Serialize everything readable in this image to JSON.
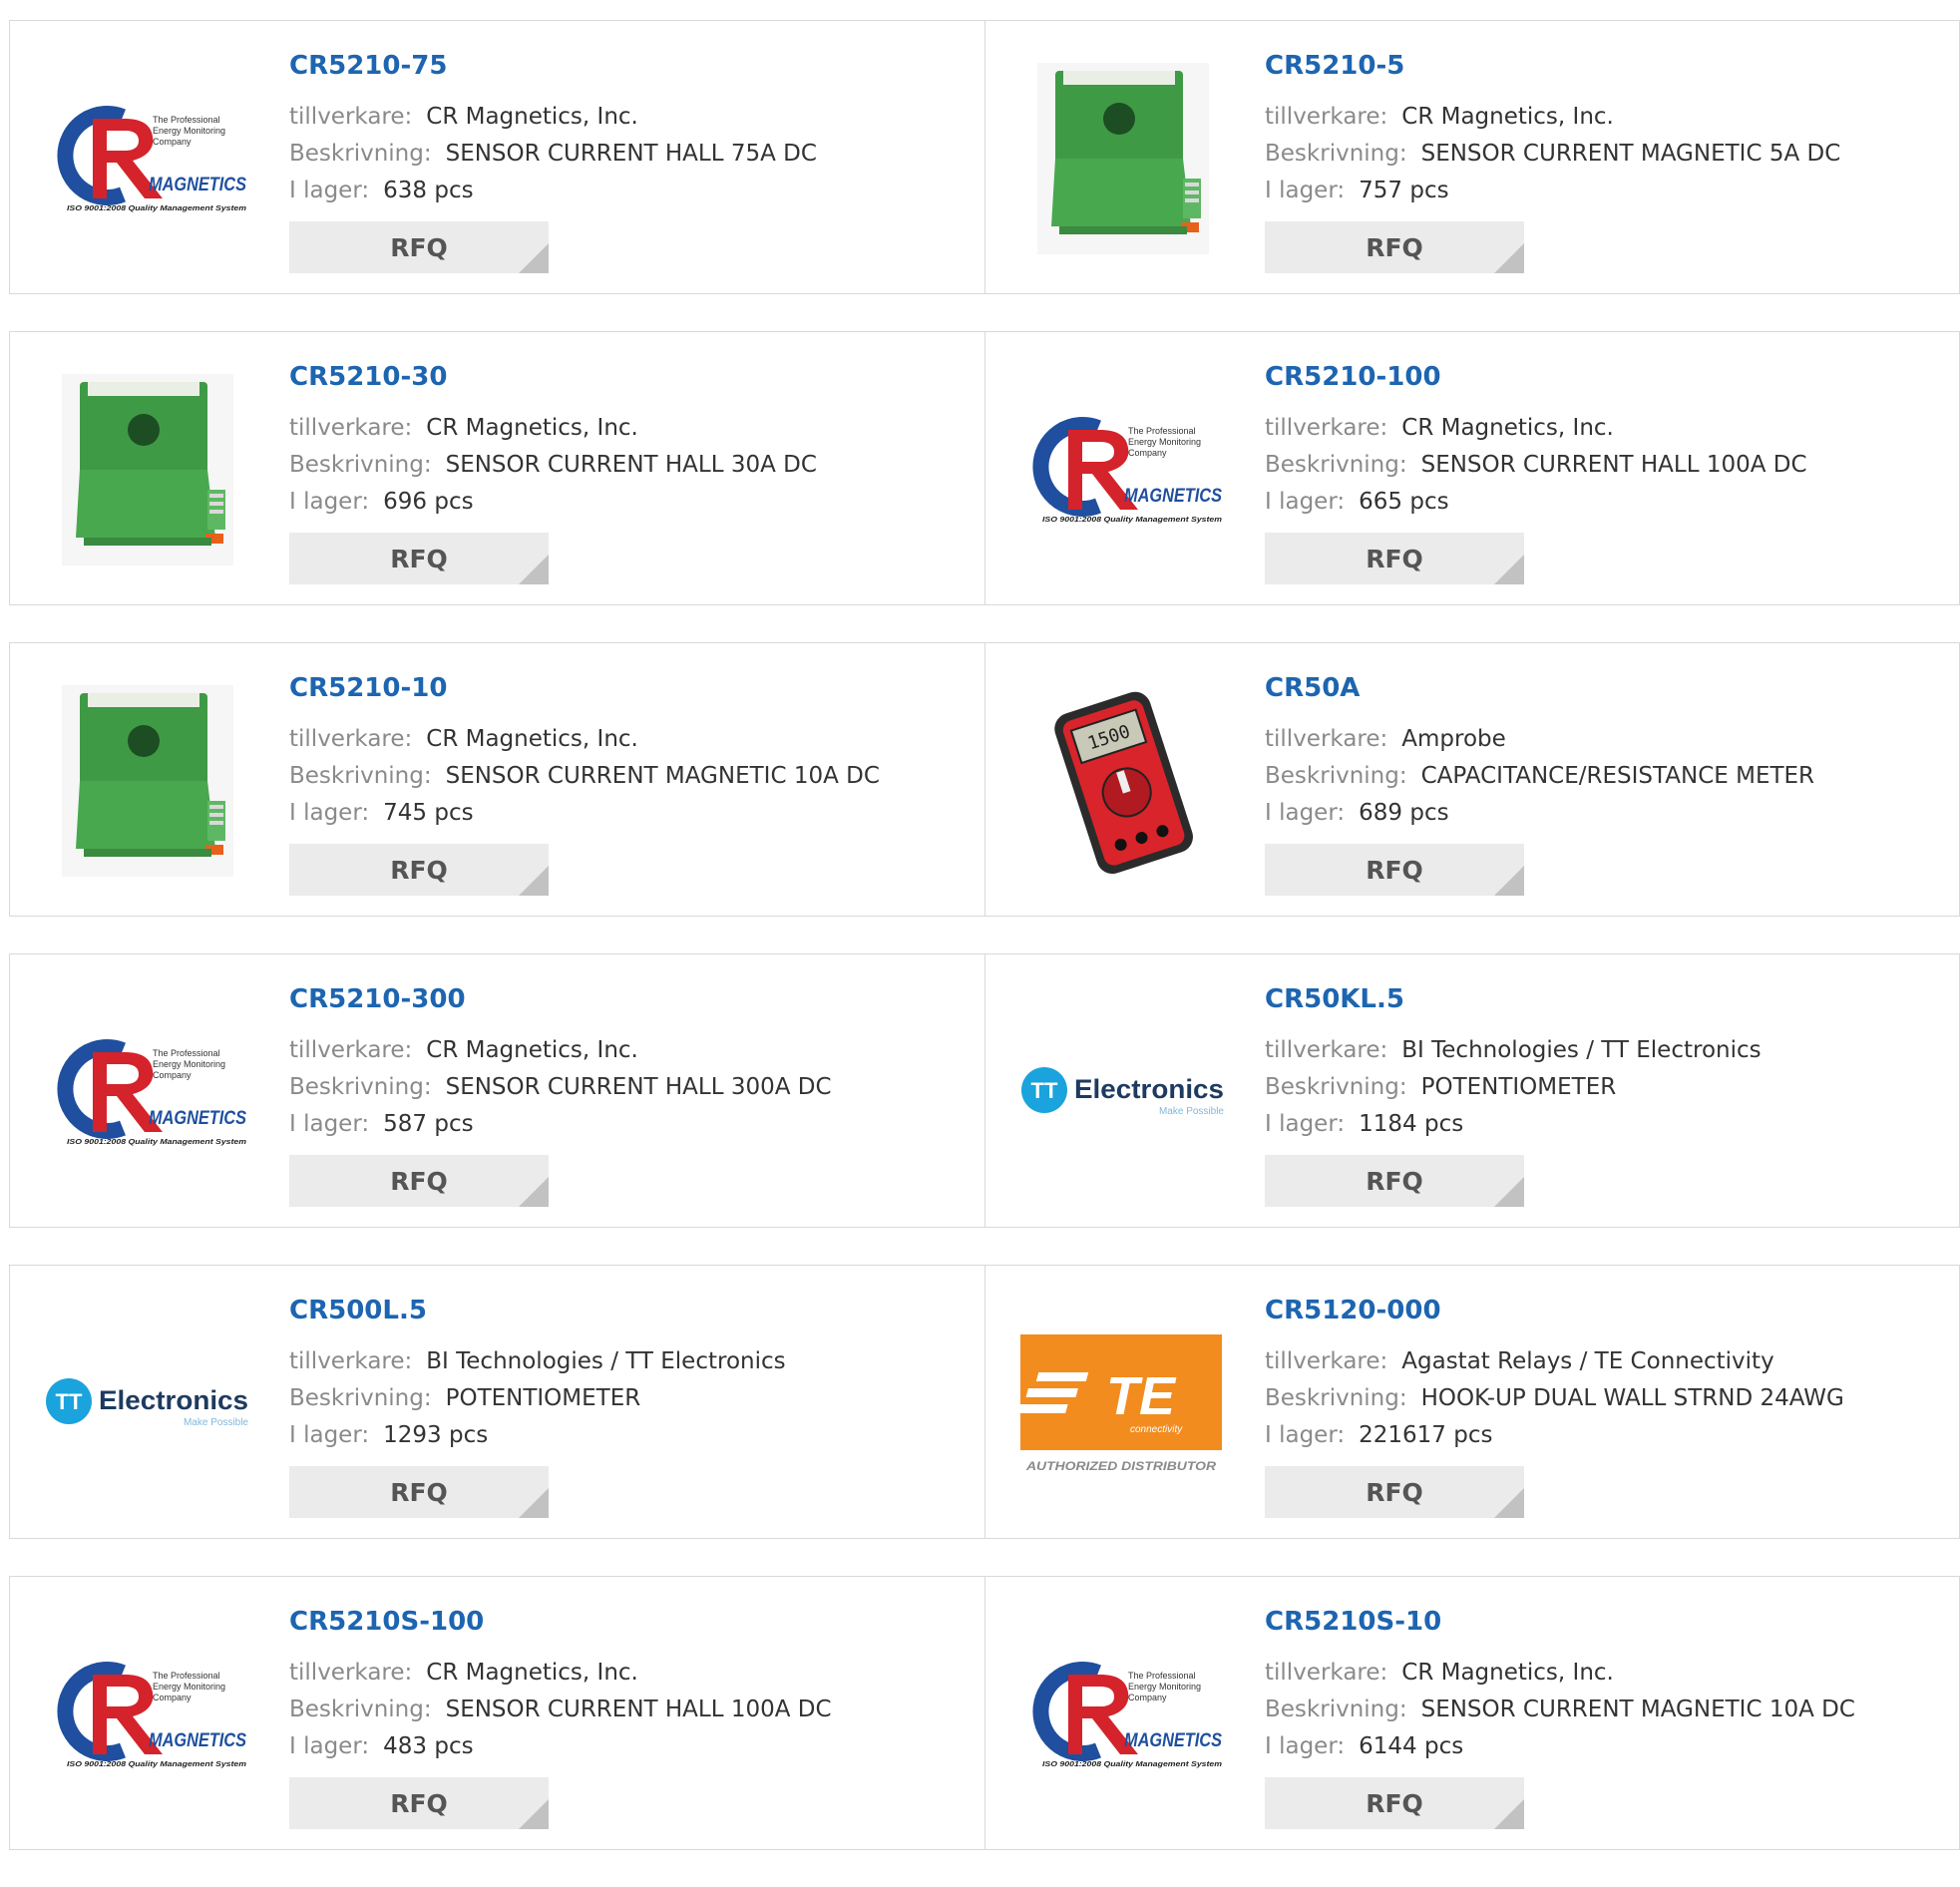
{
  "labels": {
    "manufacturer": "tillverkare:",
    "description": "Beskrivning:",
    "stock": "I lager:",
    "rfq": "RFQ"
  },
  "logo_text": {
    "cr_tagline_1": "The Professional",
    "cr_tagline_2": "Energy Monitoring",
    "cr_tagline_3": "Company",
    "cr_brand": "MAGNETICS",
    "cr_iso": "ISO 9001:2008 Quality Management System",
    "tt_brand": "Electronics",
    "tt_tag": "Make Possible",
    "te_sub": "connectivity",
    "te_auth": "AUTHORIZED DISTRIBUTOR"
  },
  "products": [
    {
      "part": "CR5210-75",
      "manufacturer": "CR Magnetics, Inc.",
      "description": "SENSOR CURRENT HALL 75A DC",
      "stock": "638 pcs",
      "image": "cr-magnetics-logo"
    },
    {
      "part": "CR5210-5",
      "manufacturer": "CR Magnetics, Inc.",
      "description": "SENSOR CURRENT MAGNETIC 5A DC",
      "stock": "757 pcs",
      "image": "green-current-sensor"
    },
    {
      "part": "CR5210-30",
      "manufacturer": "CR Magnetics, Inc.",
      "description": "SENSOR CURRENT HALL 30A DC",
      "stock": "696 pcs",
      "image": "green-current-sensor"
    },
    {
      "part": "CR5210-100",
      "manufacturer": "CR Magnetics, Inc.",
      "description": "SENSOR CURRENT HALL 100A DC",
      "stock": "665 pcs",
      "image": "cr-magnetics-logo"
    },
    {
      "part": "CR5210-10",
      "manufacturer": "CR Magnetics, Inc.",
      "description": "SENSOR CURRENT MAGNETIC 10A DC",
      "stock": "745 pcs",
      "image": "green-current-sensor"
    },
    {
      "part": "CR50A",
      "manufacturer": "Amprobe",
      "description": "CAPACITANCE/RESISTANCE METER",
      "stock": "689 pcs",
      "image": "red-multimeter",
      "meter_reading": "1500"
    },
    {
      "part": "CR5210-300",
      "manufacturer": "CR Magnetics, Inc.",
      "description": "SENSOR CURRENT HALL 300A DC",
      "stock": "587 pcs",
      "image": "cr-magnetics-logo"
    },
    {
      "part": "CR50KL.5",
      "manufacturer": "BI Technologies / TT Electronics",
      "description": "POTENTIOMETER",
      "stock": "1184 pcs",
      "image": "tt-electronics-logo"
    },
    {
      "part": "CR500L.5",
      "manufacturer": "BI Technologies / TT Electronics",
      "description": "POTENTIOMETER",
      "stock": "1293 pcs",
      "image": "tt-electronics-logo"
    },
    {
      "part": "CR5120-000",
      "manufacturer": "Agastat Relays / TE Connectivity",
      "description": "HOOK-UP DUAL WALL STRND 24AWG",
      "stock": "221617 pcs",
      "image": "te-connectivity-logo"
    },
    {
      "part": "CR5210S-100",
      "manufacturer": "CR Magnetics, Inc.",
      "description": "SENSOR CURRENT HALL 100A DC",
      "stock": "483 pcs",
      "image": "cr-magnetics-logo"
    },
    {
      "part": "CR5210S-10",
      "manufacturer": "CR Magnetics, Inc.",
      "description": "SENSOR CURRENT MAGNETIC 10A DC",
      "stock": "6144 pcs",
      "image": "cr-magnetics-logo"
    }
  ]
}
